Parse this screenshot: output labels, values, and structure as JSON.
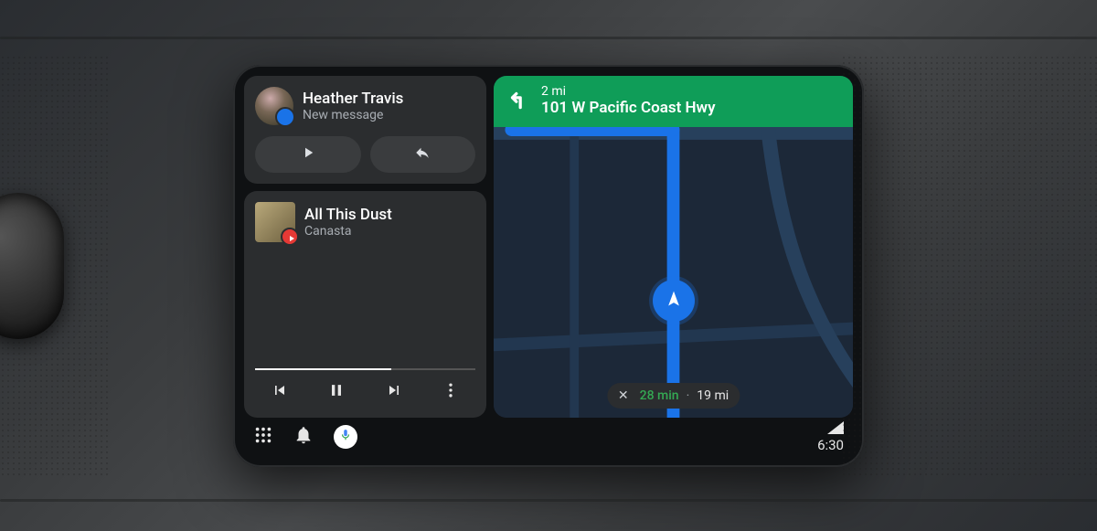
{
  "notification": {
    "sender": "Heather Travis",
    "subtitle": "New message"
  },
  "music": {
    "title": "All This Dust",
    "artist": "Canasta"
  },
  "navigation": {
    "distance": "2 mi",
    "road": "101 W Pacific Coast Hwy",
    "eta_time": "28 min",
    "eta_dist": "19 mi"
  },
  "status": {
    "clock": "6:30"
  },
  "colors": {
    "accent_blue": "#1a73e8",
    "accent_green": "#0f9d58",
    "eta_green": "#34a853",
    "card_bg": "#2b2d2f",
    "map_bg": "#1f2a3a"
  }
}
